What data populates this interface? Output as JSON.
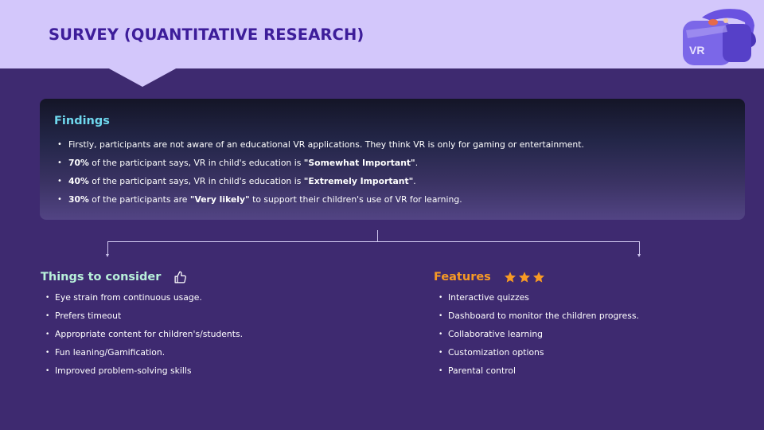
{
  "slide": {
    "title": "SURVEY (QUANTITATIVE RESEARCH)",
    "logo_text": "VR"
  },
  "findings": {
    "title": "Findings",
    "items": [
      {
        "pre": "",
        "bold1": "",
        "mid": "Firstly, participants are not aware of an educational VR applications. They think VR is only for gaming or entertainment.",
        "bold2": "",
        "post": ""
      },
      {
        "pre": "",
        "bold1": "70%",
        "mid": " of the participant says, VR in child's education is ",
        "bold2": "\"Somewhat Important\"",
        "post": "."
      },
      {
        "pre": "",
        "bold1": "40%",
        "mid": " of the participant says, VR in child's education is ",
        "bold2": "\"Extremely Important\"",
        "post": "."
      },
      {
        "pre": "",
        "bold1": "30%",
        "mid": " of the participants are ",
        "bold2": "\"Very likely\"",
        "post": " to support their children's use of VR for learning."
      }
    ]
  },
  "consider": {
    "title": "Things to consider",
    "icon": "thumbs-up-icon",
    "items": [
      "Eye strain from continuous usage.",
      "Prefers timeout",
      "Appropriate content for children's/students.",
      "Fun leaning/Gamification.",
      "Improved problem-solving skills"
    ]
  },
  "features": {
    "title": "Features",
    "icon": "star-icon",
    "items": [
      "Interactive quizzes",
      "Dashboard to monitor the children progress.",
      "Collaborative learning",
      "Customization options",
      "Parental control"
    ]
  },
  "colors": {
    "background": "#3e2a70",
    "header": "#d3c7fb",
    "title": "#3d1d9a",
    "findings_title": "#6fd8ee",
    "consider_title": "#b8f0da",
    "features_title": "#f79a24",
    "star": "#f79a24"
  }
}
